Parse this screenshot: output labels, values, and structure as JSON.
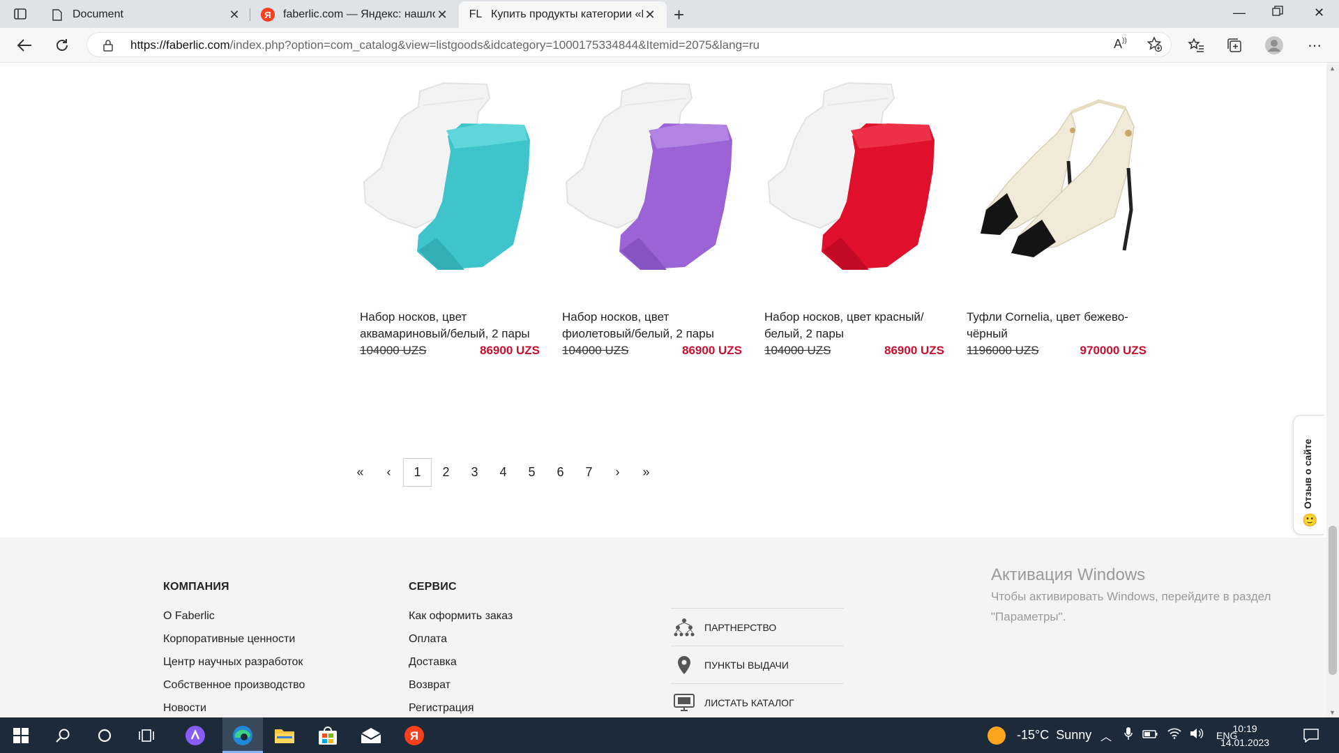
{
  "browser": {
    "tabs": [
      {
        "title": "Document",
        "favicon": "document-icon"
      },
      {
        "title": "faberlic.com — Яндекс: нашлось",
        "favicon": "yandex-icon"
      },
      {
        "title": "Купить продукты категории «М",
        "favicon": "faberlic-icon",
        "favicon_text": "FL"
      }
    ],
    "url_domain": "https://faberlic.com",
    "url_rest": "/index.php?option=com_catalog&view=listgoods&idcategory=1000175334844&Itemid=2075&lang=ru"
  },
  "products": [
    {
      "name": "Набор носков, цвет аквамариновый/белый, 2 пары",
      "old_price": "104000 UZS",
      "new_price": "86900 UZS",
      "color": "#3fc4cc"
    },
    {
      "name": "Набор носков, цвет фиолетовый/белый, 2 пары",
      "old_price": "104000 UZS",
      "new_price": "86900 UZS",
      "color": "#9b63d6"
    },
    {
      "name": "Набор носков, цвет красный/белый, 2 пары",
      "old_price": "104000 UZS",
      "new_price": "86900 UZS",
      "color": "#e0102c"
    },
    {
      "name": "Туфли Cornelia, цвет бежево-чёрный",
      "old_price": "1196000 UZS",
      "new_price": "970000 UZS",
      "color": "#f1ead8"
    }
  ],
  "pagination": {
    "first": "«",
    "prev": "‹",
    "next": "›",
    "last": "»",
    "pages": [
      "1",
      "2",
      "3",
      "4",
      "5",
      "6",
      "7"
    ],
    "current": "1"
  },
  "feedback_tab": {
    "label": "Отзыв о сайте"
  },
  "footer": {
    "company": {
      "heading": "КОМПАНИЯ",
      "links": [
        "О Faberlic",
        "Корпоративные ценности",
        "Центр научных разработок",
        "Собственное производство",
        "Новости"
      ]
    },
    "service": {
      "heading": "СЕРВИС",
      "links": [
        "Как оформить заказ",
        "Оплата",
        "Доставка",
        "Возврат",
        "Регистрация"
      ]
    },
    "quick": [
      {
        "label": "ПАРТНЕРСТВО",
        "icon": "partnership-icon"
      },
      {
        "label": "ПУНКТЫ ВЫДАЧИ",
        "icon": "map-pin-icon"
      },
      {
        "label": "ЛИСТАТЬ КАТАЛОГ",
        "icon": "catalog-monitor-icon"
      }
    ]
  },
  "activation": {
    "title": "Активация Windows",
    "text1": "Чтобы активировать Windows, перейдите в раздел",
    "text2": "\"Параметры\"."
  },
  "taskbar": {
    "weather_temp": "-15°C",
    "weather_text": "Sunny",
    "lang": "ENG",
    "time": "10:19",
    "date": "14.01.2023"
  }
}
